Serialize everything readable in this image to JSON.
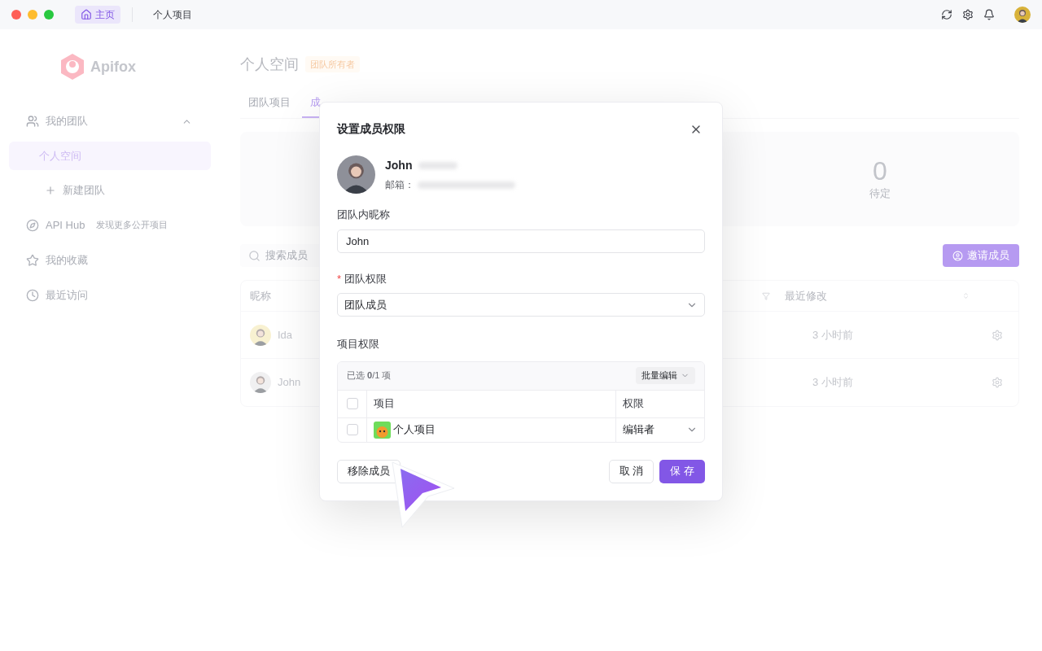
{
  "titlebar": {
    "tabs": [
      {
        "label": "主页",
        "kind": "home",
        "selected": true
      },
      {
        "label": "个人项目",
        "kind": "plain",
        "selected": false
      }
    ]
  },
  "sidebar": {
    "logo": "Apifox",
    "team": {
      "label": "我的团队",
      "expanded": true,
      "teams": [
        {
          "label": "个人空间",
          "selected": true
        }
      ],
      "new_team": "新建团队"
    },
    "links": [
      {
        "label": "API Hub",
        "note": "发现更多公开项目",
        "kind": "compass"
      },
      {
        "label": "我的收藏",
        "kind": "star"
      },
      {
        "label": "最近访问",
        "kind": "clock"
      }
    ]
  },
  "header": {
    "title": "个人空间",
    "badge": "团队所有者"
  },
  "tabs": [
    {
      "label": "团队项目",
      "selected": false
    },
    {
      "label": "成",
      "selected": true
    }
  ],
  "stats": {
    "value": "0",
    "label": "待定"
  },
  "search": {
    "placeholder": "搜索成员"
  },
  "invite_button": "邀请成员",
  "table": {
    "columns": [
      "昵称",
      "最近修改"
    ],
    "rows": [
      {
        "name": "Ida",
        "modified": "3 小时前"
      },
      {
        "name": "John",
        "modified": "3 小时前"
      }
    ]
  },
  "modal": {
    "title": "设置成员权限",
    "user": {
      "name": "John",
      "email_label": "邮箱："
    },
    "nickname": {
      "label": "团队内昵称",
      "value": "John"
    },
    "role": {
      "label": "团队权限",
      "required_mark": "*",
      "value": "团队成员"
    },
    "projects": {
      "label": "项目权限",
      "summary": "已选 **0**/1 项",
      "batch": "批量编辑",
      "header_checked": false,
      "columns": [
        "项目",
        "权限"
      ],
      "rows": [
        {
          "name": "个人项目",
          "permission": "编辑者",
          "checked": false
        }
      ]
    },
    "remove": "移除成员",
    "cancel": "取 消",
    "save": "保 存"
  }
}
